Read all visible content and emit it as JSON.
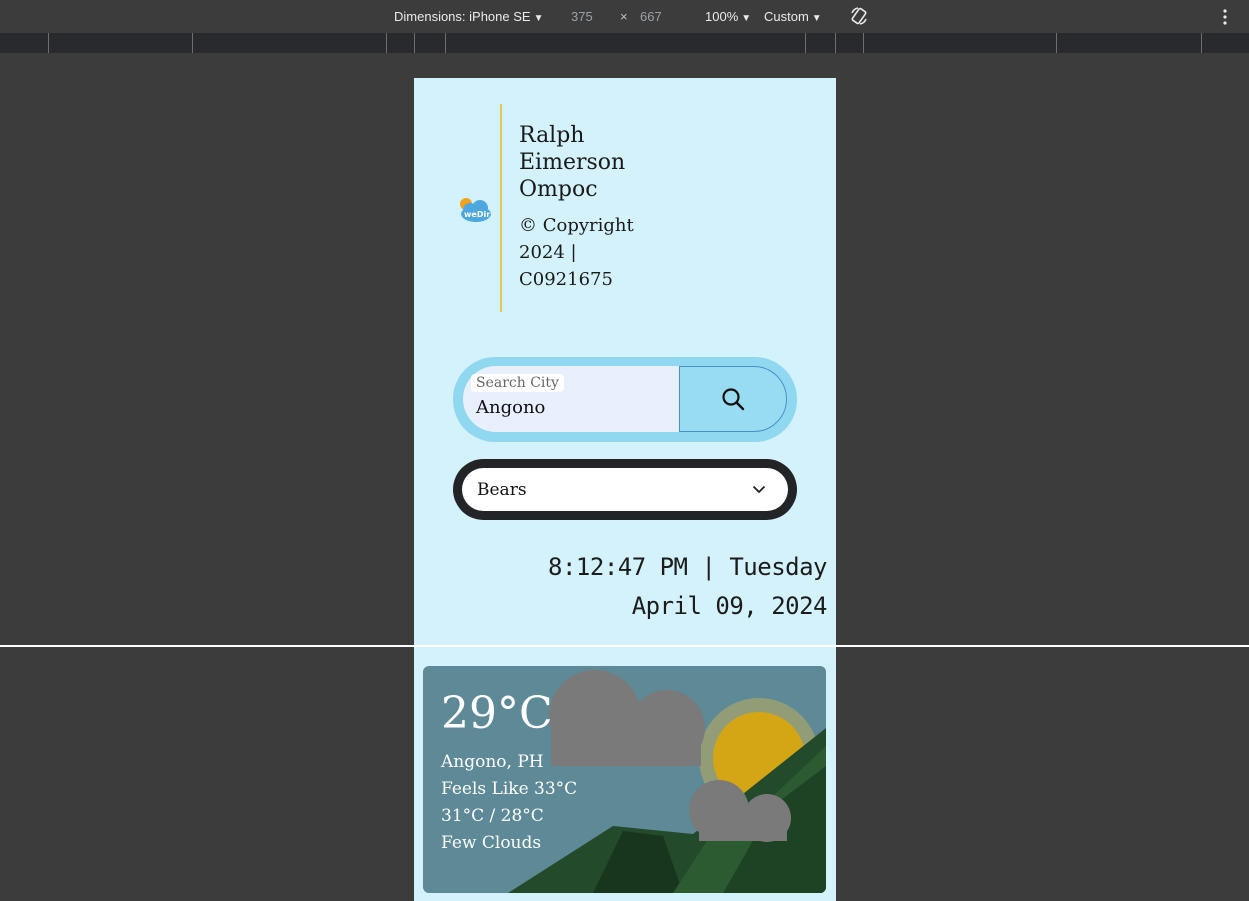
{
  "devtools": {
    "dimensions_label": "Dimensions: iPhone SE",
    "width": "375",
    "times": "×",
    "height": "667",
    "zoom": "100%",
    "throttle": "Custom",
    "rotate_icon": "rotate-icon",
    "menu_icon": "more-vert-icon"
  },
  "app": {
    "logo_icon": "weather-cloud-sun-logo",
    "logo_text": "weDir",
    "author_name": "Ralph Eimerson Ompoc",
    "copyright": "© Copyright 2024 | C0921675",
    "accent_line_color": "#e8c84a",
    "background_color": "#d4f2fb"
  },
  "search": {
    "label": "Search City",
    "value": "Angono",
    "button_icon": "search-icon"
  },
  "theme_select": {
    "selected": "Bears",
    "icon": "chevron-down-icon"
  },
  "clock": {
    "time_line": "8:12:47 PM | Tuesday",
    "date_line": "April 09, 2024"
  },
  "weather": {
    "temperature": "29°C",
    "location": "Angono, PH",
    "feels_like": "Feels Like 33°C",
    "range": "31°C / 28°C",
    "description": "Few Clouds",
    "illustration": "sun-clouds-mountains"
  }
}
